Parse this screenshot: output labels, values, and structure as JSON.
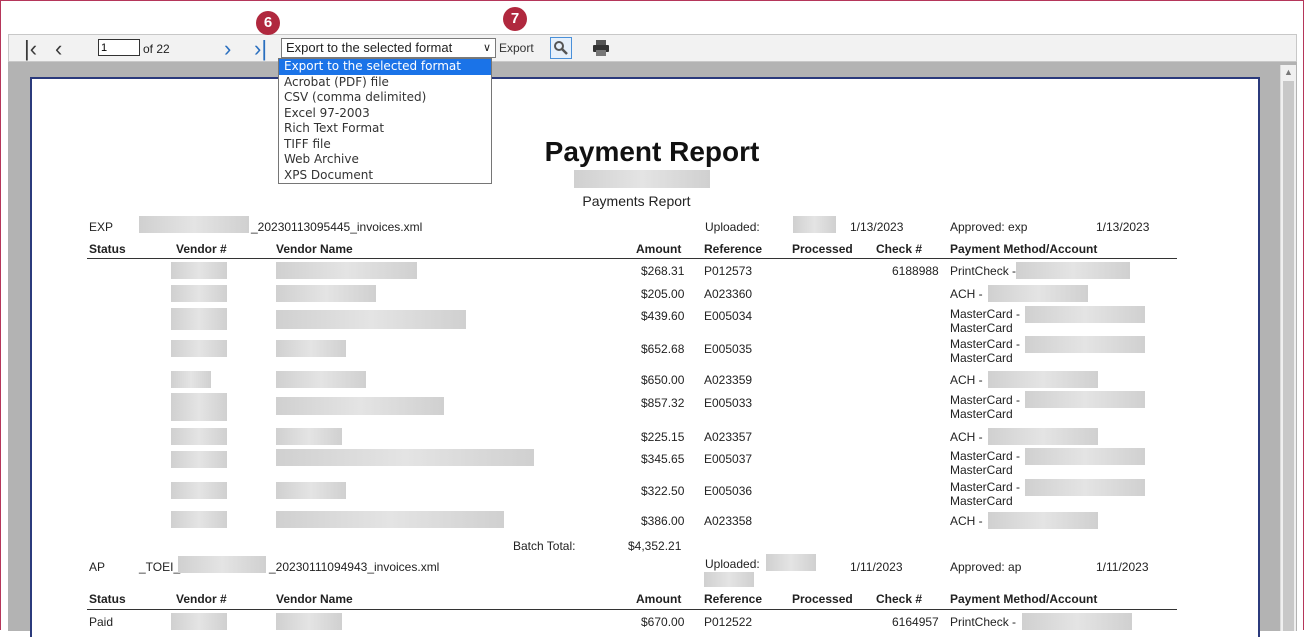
{
  "toolbar": {
    "page_value": "1",
    "of_label": "of 22",
    "format_selected": "Export to the selected format",
    "export_label": "Export",
    "badge_6": "6",
    "badge_7": "7",
    "icons": [
      "first-page-icon",
      "prev-page-icon",
      "next-page-icon",
      "last-page-icon",
      "search-icon",
      "printer-icon"
    ]
  },
  "dropdown_options": [
    "Export to the selected format",
    "Acrobat (PDF) file",
    "CSV (comma delimited)",
    "Excel 97-2003",
    "Rich Text Format",
    "TIFF file",
    "Web Archive",
    "XPS Document"
  ],
  "report": {
    "title": "Payment Report",
    "subtitle": "Payments Report",
    "columns": {
      "status": "Status",
      "vendor_no": "Vendor #",
      "vendor_name": "Vendor Name",
      "amount": "Amount",
      "reference": "Reference",
      "processed": "Processed",
      "check_no": "Check #",
      "method": "Payment Method/Account"
    },
    "batch1": {
      "code": "EXP",
      "file": "_20230113095445_invoices.xml",
      "uploaded_label": "Uploaded:",
      "uploaded_date": "1/13/2023",
      "approved": "Approved: exp",
      "approved_date": "1/13/2023",
      "rows": [
        {
          "amount": "$268.31",
          "ref": "P012573",
          "check": "6188988",
          "method": "PrintCheck -",
          "method2": ""
        },
        {
          "amount": "$205.00",
          "ref": "A023360",
          "check": "",
          "method": "ACH -",
          "method2": ""
        },
        {
          "amount": "$439.60",
          "ref": "E005034",
          "check": "",
          "method": "MasterCard -",
          "method2": "MasterCard"
        },
        {
          "amount": "$652.68",
          "ref": "E005035",
          "check": "",
          "method": "MasterCard -",
          "method2": "MasterCard"
        },
        {
          "amount": "$650.00",
          "ref": "A023359",
          "check": "",
          "method": "ACH -",
          "method2": ""
        },
        {
          "amount": "$857.32",
          "ref": "E005033",
          "check": "",
          "method": "MasterCard -",
          "method2": "MasterCard"
        },
        {
          "amount": "$225.15",
          "ref": "A023357",
          "check": "",
          "method": "ACH -",
          "method2": ""
        },
        {
          "amount": "$345.65",
          "ref": "E005037",
          "check": "",
          "method": "MasterCard -",
          "method2": "MasterCard"
        },
        {
          "amount": "$322.50",
          "ref": "E005036",
          "check": "",
          "method": "MasterCard -",
          "method2": "MasterCard"
        },
        {
          "amount": "$386.00",
          "ref": "A023358",
          "check": "",
          "method": "ACH -",
          "method2": ""
        }
      ],
      "batch_total_label": "Batch Total:",
      "batch_total": "$4,352.21"
    },
    "batch2": {
      "code": "AP",
      "prefix": "_TOEI_",
      "file": "_20230111094943_invoices.xml",
      "uploaded_label": "Uploaded:",
      "uploaded_date": "1/11/2023",
      "approved": "Approved: ap",
      "approved_date": "1/11/2023",
      "row": {
        "status": "Paid",
        "amount": "$670.00",
        "ref": "P012522",
        "check": "6164957",
        "method": "PrintCheck -"
      }
    }
  }
}
